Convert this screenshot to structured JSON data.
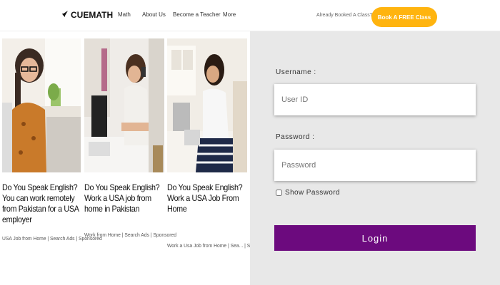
{
  "header": {
    "logo_text": "CUEMATH",
    "nav": [
      "Math",
      "About Us",
      "Become a Teacher",
      "More"
    ],
    "already_booked": "Already Booked A Class?",
    "book_button": "Book A FREE Class",
    "accent_color": "#ffb40f"
  },
  "ads": [
    {
      "title": "Do You Speak English? You can work remotely from Pakistan for a USA employer",
      "meta": "USA Job from Home | Search Ads | Sponsored"
    },
    {
      "title": "Do You Speak English? Work a USA job from home in Pakistan",
      "meta": "Work from Home | Search Ads | Sponsored"
    },
    {
      "title": "Do You Speak English? Work a USA Job From Home",
      "meta": "Work a Usa Job from Home | Sea... | Sponsored"
    }
  ],
  "login": {
    "username_label": "Username :",
    "username_placeholder": "User ID",
    "password_label": "Password :",
    "password_placeholder": "Password",
    "show_password_label": "Show Password",
    "login_button": "Login",
    "button_color": "#6c0a7e"
  }
}
